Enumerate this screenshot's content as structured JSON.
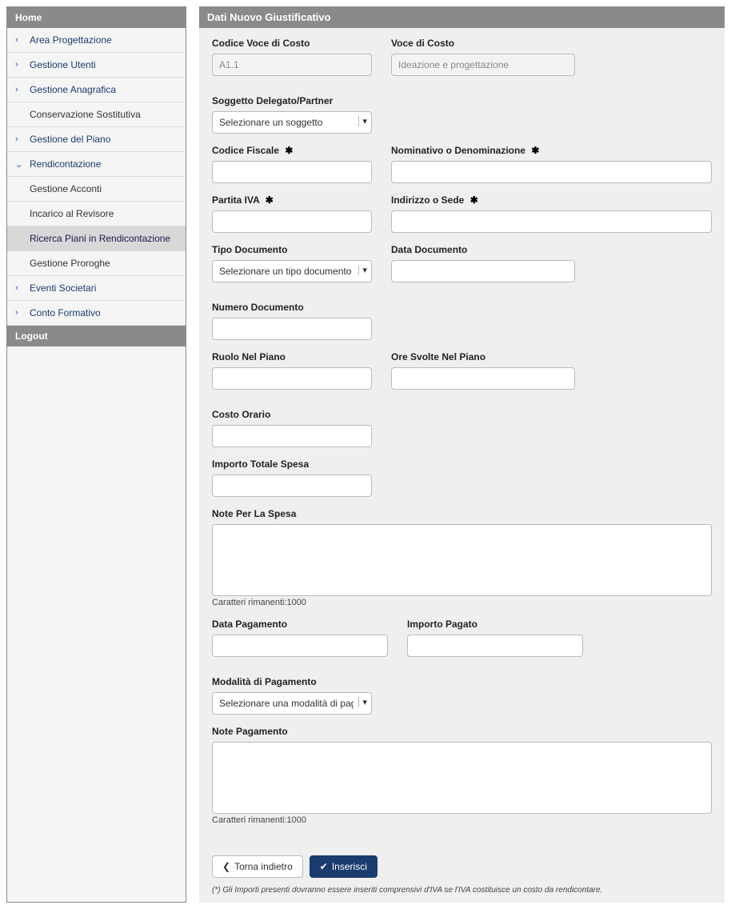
{
  "sidebar": {
    "header": "Home",
    "footer": "Logout",
    "items": [
      {
        "label": "Area Progettazione",
        "chev": "›",
        "sub": false
      },
      {
        "label": "Gestione Utenti",
        "chev": "›",
        "sub": false
      },
      {
        "label": "Gestione Anagrafica",
        "chev": "›",
        "sub": false
      },
      {
        "label": "Conservazione Sostitutiva",
        "chev": "",
        "sub": true
      },
      {
        "label": "Gestione del Piano",
        "chev": "›",
        "sub": false
      },
      {
        "label": "Rendicontazione",
        "chev": "⌄",
        "sub": false
      },
      {
        "label": "Gestione Acconti",
        "chev": "",
        "sub": true
      },
      {
        "label": "Incarico al Revisore",
        "chev": "",
        "sub": true
      },
      {
        "label": "Ricerca Piani in Rendicontazione",
        "chev": "",
        "sub": true,
        "active": true
      },
      {
        "label": "Gestione Proroghe",
        "chev": "",
        "sub": true
      },
      {
        "label": "Eventi Societari",
        "chev": "›",
        "sub": false
      },
      {
        "label": "Conto Formativo",
        "chev": "›",
        "sub": false
      }
    ]
  },
  "panel": {
    "title": "Dati Nuovo Giustificativo"
  },
  "form": {
    "codice_voce_costo": {
      "label": "Codice Voce di Costo",
      "value": "A1.1"
    },
    "voce_di_costo": {
      "label": "Voce di Costo",
      "value": "Ideazione e progettazione"
    },
    "soggetto": {
      "label": "Soggetto Delegato/Partner",
      "placeholder": "Selezionare un soggetto"
    },
    "codice_fiscale": {
      "label": "Codice Fiscale",
      "required": "✱"
    },
    "nominativo": {
      "label": "Nominativo o Denominazione",
      "required": "✱"
    },
    "partita_iva": {
      "label": "Partita IVA",
      "required": "✱"
    },
    "indirizzo": {
      "label": "Indirizzo o Sede",
      "required": "✱"
    },
    "tipo_documento": {
      "label": "Tipo Documento",
      "placeholder": "Selezionare un tipo documento"
    },
    "data_documento": {
      "label": "Data Documento"
    },
    "numero_documento": {
      "label": "Numero Documento"
    },
    "ruolo": {
      "label": "Ruolo Nel Piano"
    },
    "ore_svolte": {
      "label": "Ore Svolte Nel Piano"
    },
    "costo_orario": {
      "label": "Costo Orario"
    },
    "importo_totale": {
      "label": "Importo Totale Spesa"
    },
    "note_spesa": {
      "label": "Note Per La Spesa",
      "counter": "Caratteri rimanenti:1000"
    },
    "data_pagamento": {
      "label": "Data Pagamento"
    },
    "importo_pagato": {
      "label": "Importo Pagato"
    },
    "modalita_pagamento": {
      "label": "Modalità di Pagamento",
      "placeholder": "Selezionare una modalità di pagam"
    },
    "note_pagamento": {
      "label": "Note Pagamento",
      "counter": "Caratteri rimanenti:1000"
    }
  },
  "buttons": {
    "back": "Torna indietro",
    "back_icon": "❮",
    "insert": "Inserisci",
    "insert_icon": "✔"
  },
  "footnote": "(*) Gli Importi presenti dovranno essere inseriti comprensivi d'IVA se l'IVA costituisce un costo da rendicontare."
}
